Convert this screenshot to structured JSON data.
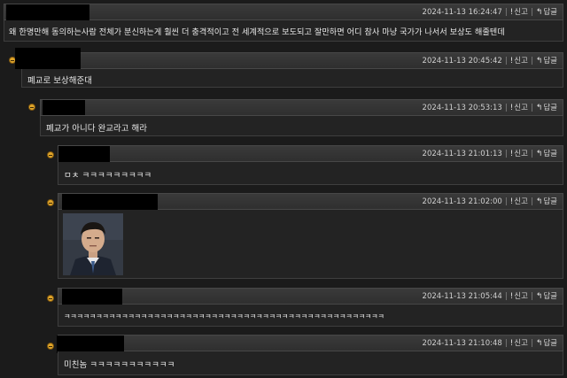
{
  "actions": {
    "report_label": "신고",
    "reply_label": "답글"
  },
  "comments": [
    {
      "timestamp": "2024-11-13 16:24:47",
      "text": "왜 한명만해 동의하는사람 전체가 분신하는게 훨씬 더 충격적이고 전 세계적으로 보도되고 잘만하면 어디 참사 마냥 국가가 나서서 보상도 해줄텐데"
    },
    {
      "timestamp": "2024-11-13 20:45:42",
      "text": "폐교로 보상해준대"
    },
    {
      "timestamp": "2024-11-13 20:53:13",
      "text": "폐교가 아니다 완교라고 해라"
    },
    {
      "timestamp": "2024-11-13 21:01:13",
      "text": "ㅁㅊ ㅋㅋㅋㅋㅋㅋㅋㅋㅋ"
    },
    {
      "timestamp": "2024-11-13 21:02:00",
      "text": ""
    },
    {
      "timestamp": "2024-11-13 21:05:44",
      "text": "ㅋㅋㅋㅋㅋㅋㅋㅋㅋㅋㅋㅋㅋㅋㅋㅋㅋㅋㅋㅋㅋㅋㅋㅋㅋㅋㅋㅋㅋㅋㅋㅋㅋㅋㅋㅋㅋㅋㅋㅋㅋㅋㅋㅋㅋㅋㅋㅋㅋㅋ"
    },
    {
      "timestamp": "2024-11-13 21:10:48",
      "text": "미친놈 ㅋㅋㅋㅋㅋㅋㅋㅋㅋㅋㅋ"
    }
  ]
}
